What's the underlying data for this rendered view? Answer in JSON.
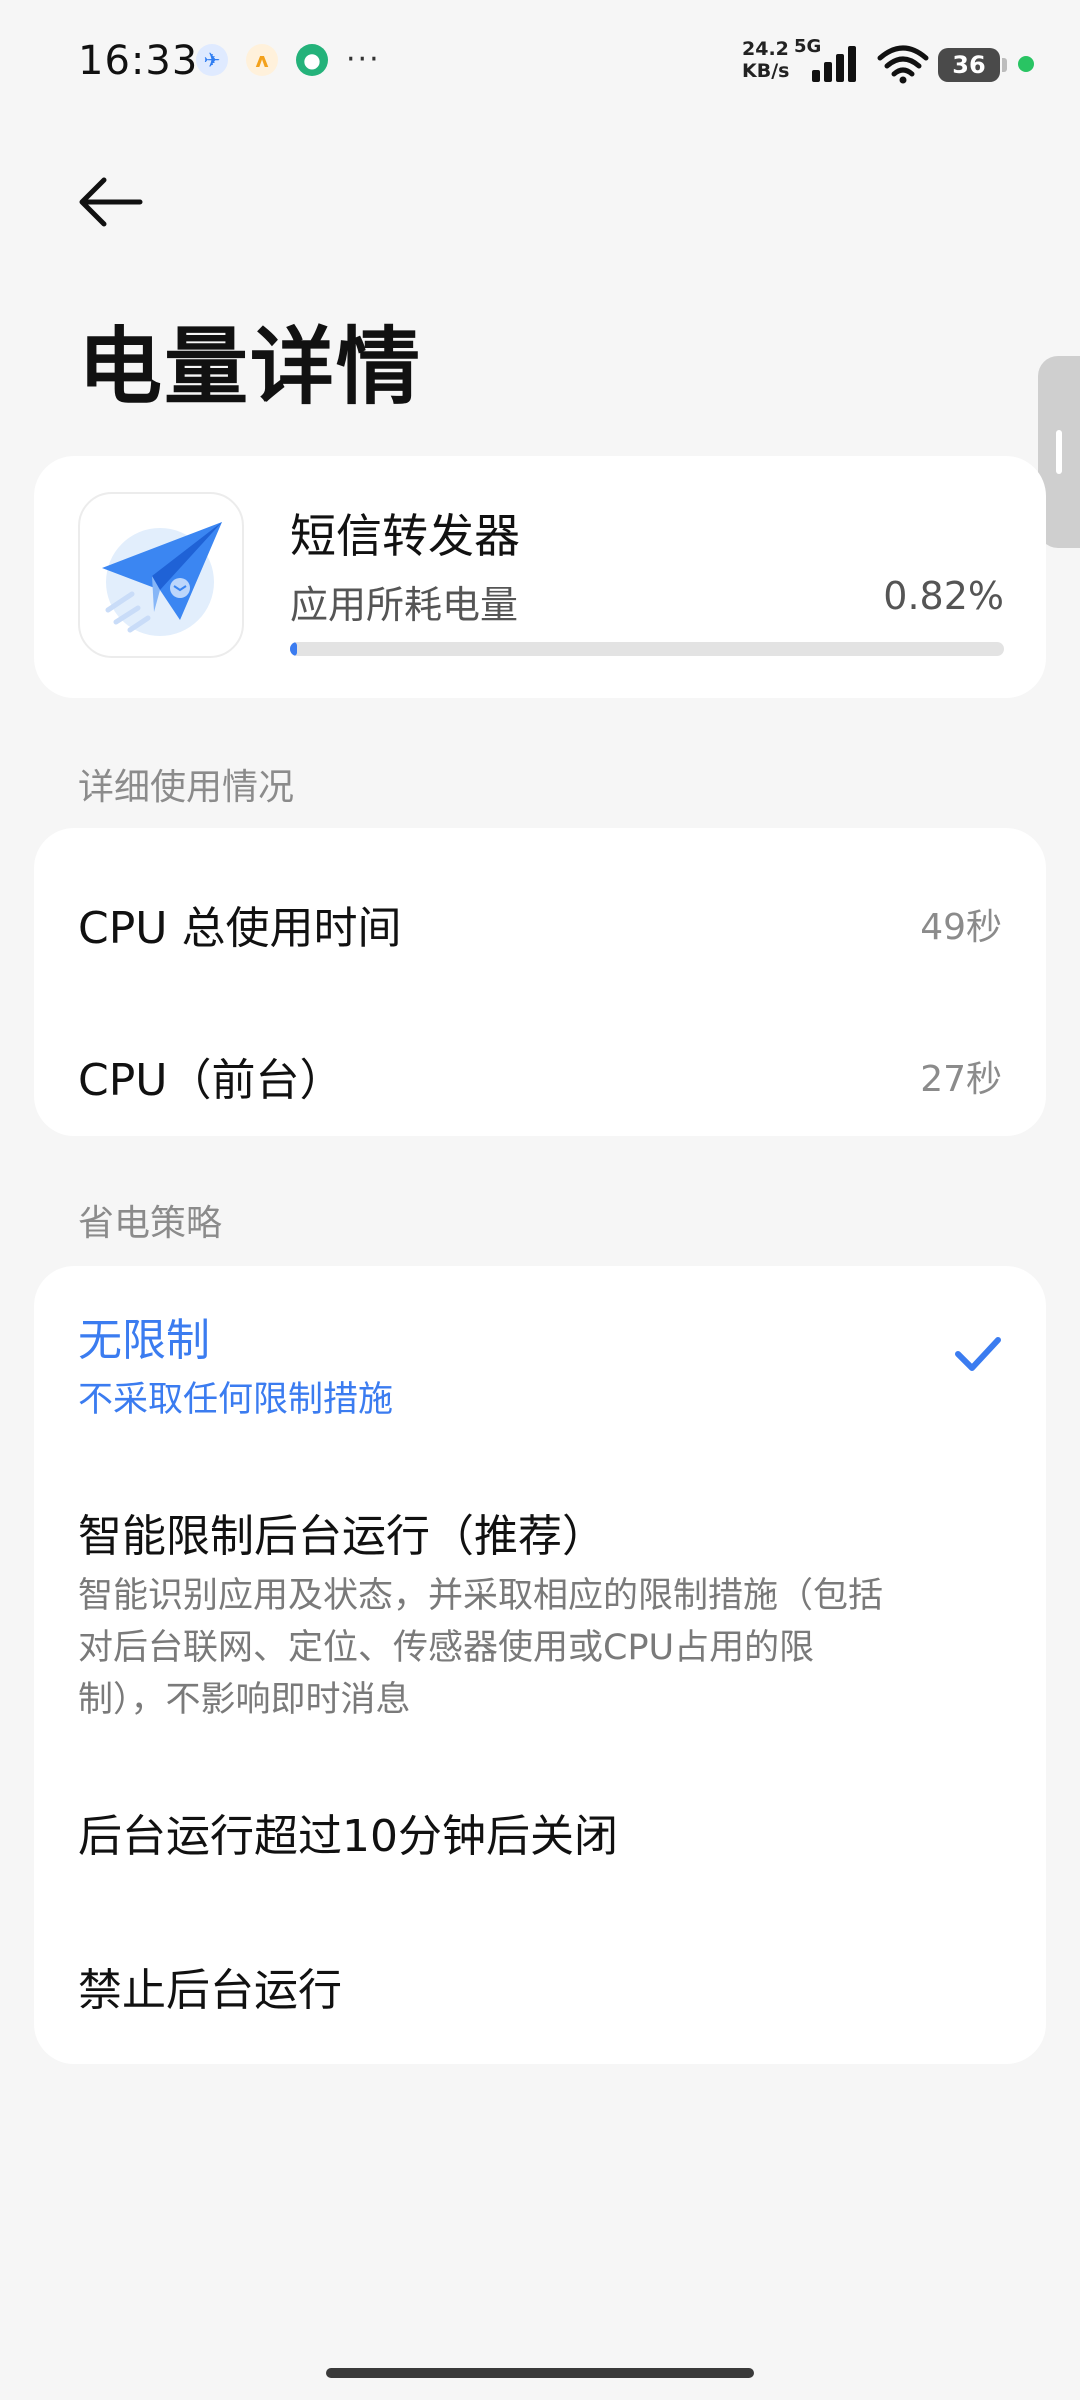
{
  "status_bar": {
    "time": "16:33",
    "net_speed_value": "24.2",
    "net_speed_unit": "KB/s",
    "network_gen": "5G",
    "battery_level": "36",
    "notification_icons": [
      "sms-forwarder-icon",
      "app-notification-icon",
      "app-notification-icon-2"
    ],
    "more": "···"
  },
  "header": {
    "title": "电量详情"
  },
  "app": {
    "name": "短信转发器",
    "usage_label": "应用所耗电量",
    "usage_value": "0.82%",
    "usage_fraction": 0.0082,
    "icon": "paper-plane-icon"
  },
  "details": {
    "section_label": "详细使用情况",
    "rows": [
      {
        "label": "CPU 总使用时间",
        "value": "49秒"
      },
      {
        "label": "CPU（前台）",
        "value": "27秒"
      }
    ]
  },
  "policy": {
    "section_label": "省电策略",
    "options": [
      {
        "title": "无限制",
        "desc": "不采取任何限制措施",
        "selected": true
      },
      {
        "title": "智能限制后台运行（推荐）",
        "desc": "智能识别应用及状态，并采取相应的限制措施（包括对后台联网、定位、传感器使用或CPU占用的限制），不影响即时消息",
        "selected": false
      },
      {
        "title": "后台运行超过10分钟后关闭",
        "desc": "",
        "selected": false
      },
      {
        "title": "禁止后台运行",
        "desc": "",
        "selected": false
      }
    ]
  },
  "colors": {
    "accent": "#3b7cf0",
    "background": "#f6f6f6",
    "card": "#ffffff"
  }
}
